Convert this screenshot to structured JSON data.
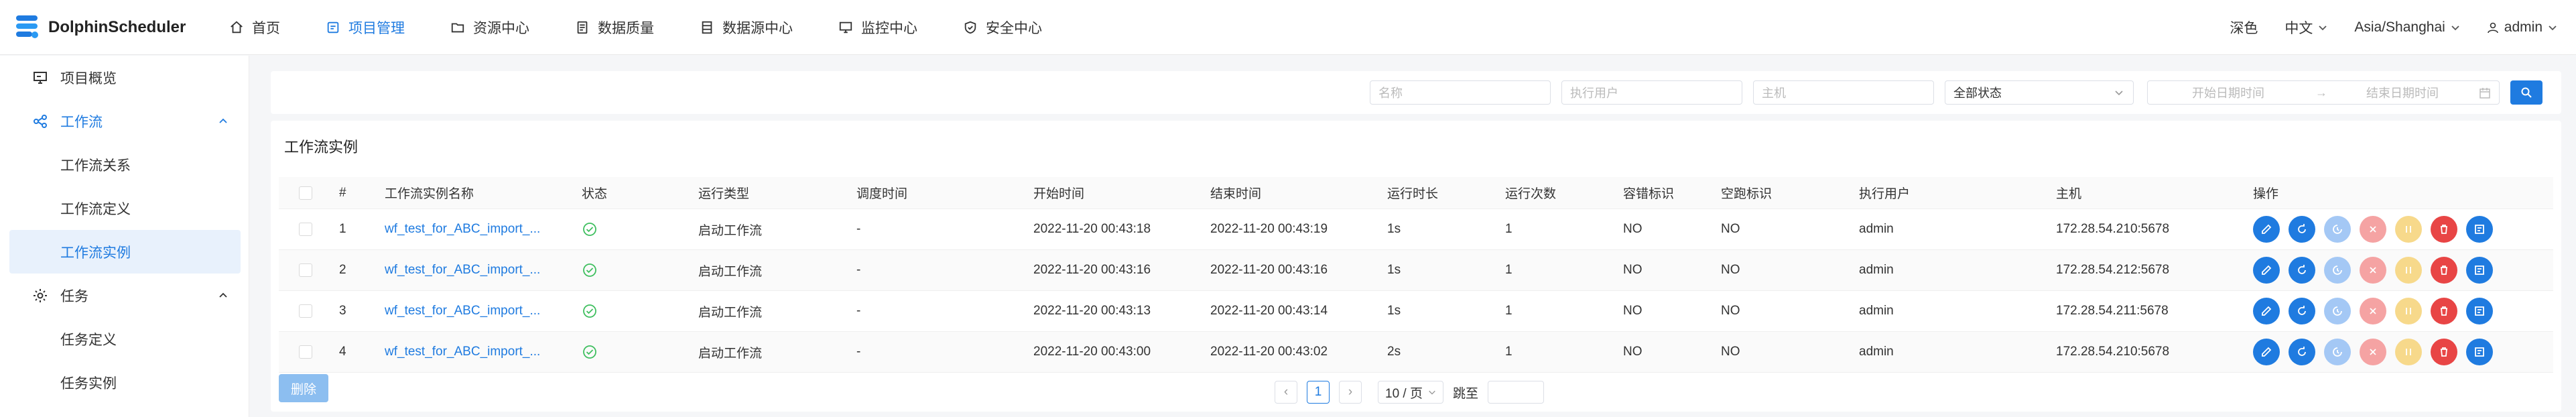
{
  "header": {
    "app_name": "DolphinScheduler",
    "nav": [
      {
        "label": "首页",
        "icon": "home-icon",
        "active": false
      },
      {
        "label": "项目管理",
        "icon": "project-icon",
        "active": true
      },
      {
        "label": "资源中心",
        "icon": "folder-icon",
        "active": false
      },
      {
        "label": "数据质量",
        "icon": "data-quality-icon",
        "active": false
      },
      {
        "label": "数据源中心",
        "icon": "datasource-icon",
        "active": false
      },
      {
        "label": "监控中心",
        "icon": "monitor-icon",
        "active": false
      },
      {
        "label": "安全中心",
        "icon": "shield-icon",
        "active": false
      }
    ],
    "theme": "深色",
    "language": "中文",
    "timezone": "Asia/Shanghai",
    "user": "admin"
  },
  "sidebar": {
    "overview": "项目概览",
    "workflow": "工作流",
    "workflow_items": [
      "工作流关系",
      "工作流定义",
      "工作流实例"
    ],
    "task": "任务",
    "task_items": [
      "任务定义",
      "任务实例"
    ]
  },
  "filters": {
    "name_placeholder": "名称",
    "executor_placeholder": "执行用户",
    "host_placeholder": "主机",
    "state_value": "全部状态",
    "start_placeholder": "开始日期时间",
    "arrow": "→",
    "end_placeholder": "结束日期时间"
  },
  "table": {
    "title": "工作流实例",
    "columns": [
      "#",
      "工作流实例名称",
      "状态",
      "运行类型",
      "调度时间",
      "开始时间",
      "结束时间",
      "运行时长",
      "运行次数",
      "容错标识",
      "空跑标识",
      "执行用户",
      "主机",
      "操作"
    ],
    "rows": [
      {
        "idx": "1",
        "name": "wf_test_for_ABC_import_...",
        "run_type": "启动工作流",
        "schedule": "-",
        "start": "2022-11-20 00:43:18",
        "end": "2022-11-20 00:43:19",
        "duration": "1s",
        "runs": "1",
        "fault": "NO",
        "dry": "NO",
        "user": "admin",
        "host": "172.28.54.210:5678"
      },
      {
        "idx": "2",
        "name": "wf_test_for_ABC_import_...",
        "run_type": "启动工作流",
        "schedule": "-",
        "start": "2022-11-20 00:43:16",
        "end": "2022-11-20 00:43:16",
        "duration": "1s",
        "runs": "1",
        "fault": "NO",
        "dry": "NO",
        "user": "admin",
        "host": "172.28.54.212:5678"
      },
      {
        "idx": "3",
        "name": "wf_test_for_ABC_import_...",
        "run_type": "启动工作流",
        "schedule": "-",
        "start": "2022-11-20 00:43:13",
        "end": "2022-11-20 00:43:14",
        "duration": "1s",
        "runs": "1",
        "fault": "NO",
        "dry": "NO",
        "user": "admin",
        "host": "172.28.54.211:5678"
      },
      {
        "idx": "4",
        "name": "wf_test_for_ABC_import_...",
        "run_type": "启动工作流",
        "schedule": "-",
        "start": "2022-11-20 00:43:00",
        "end": "2022-11-20 00:43:02",
        "duration": "2s",
        "runs": "1",
        "fault": "NO",
        "dry": "NO",
        "user": "admin",
        "host": "172.28.54.210:5678"
      }
    ],
    "op_colors": [
      "#1f7be0",
      "#1f7be0",
      "#a4c8f5",
      "#f5a3a3",
      "#f7d98b",
      "#e84545",
      "#1f7be0"
    ]
  },
  "footer": {
    "delete_label": "删除",
    "prev": "‹",
    "page": "1",
    "next": "›",
    "page_size": "10 / 页",
    "jump_label": "跳至"
  }
}
